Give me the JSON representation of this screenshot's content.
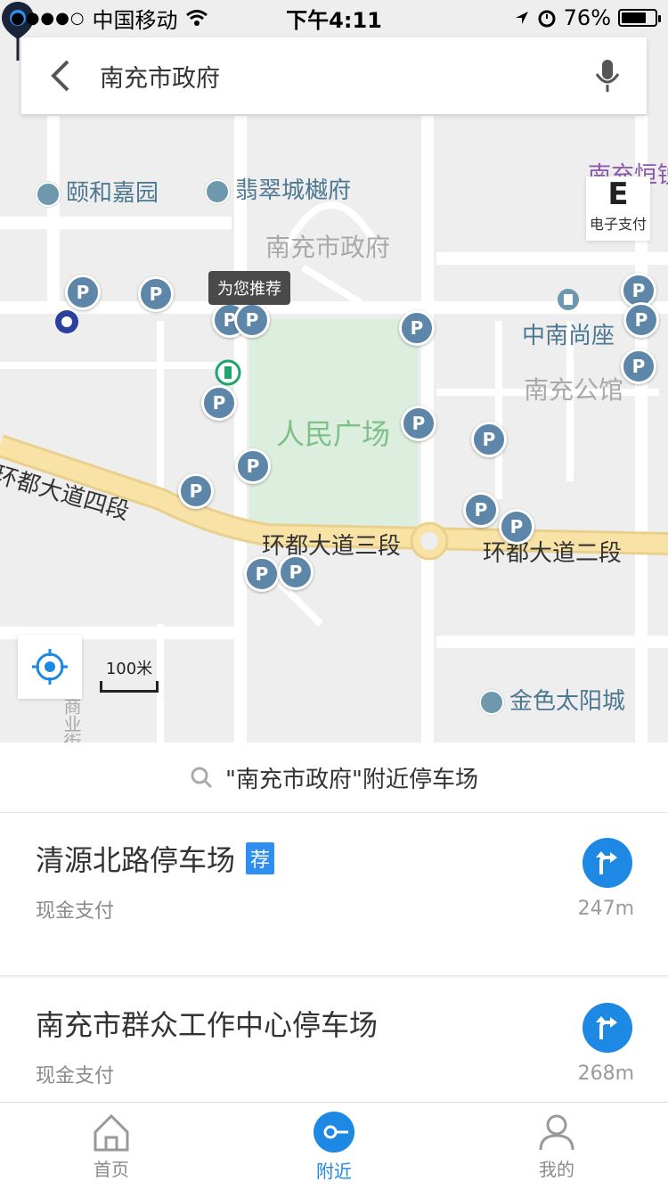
{
  "status_bar": {
    "carrier": "中国移动",
    "time": "下午4:11",
    "battery": "76%",
    "battery_level": 0.76
  },
  "search": {
    "query": "南充市政府"
  },
  "map": {
    "labels": {
      "yihe": "颐和嘉园",
      "feicui": "翡翠城樾府",
      "nanchong_gov": "南充市政府",
      "nanchong_henglong": "南充恒锐",
      "zhongnan": "中南尚座",
      "gongguan": "南充公馆",
      "park": "人民广场",
      "road4": "环都大道四段",
      "road3": "环都大道三段",
      "road2": "环都大道二段",
      "jinse": "金色太阳城",
      "shangye": "商业街"
    },
    "tooltip": "为您推荐",
    "parking_letter": "P",
    "scale": "100米"
  },
  "epay": {
    "letter": "E",
    "label": "电子支付"
  },
  "sheet": {
    "search_summary": "\"南充市政府\"附近停车场",
    "results": [
      {
        "name": "清源北路停车场",
        "badge": "荐",
        "payment": "现金支付",
        "distance": "247m"
      },
      {
        "name": "南充市群众工作中心停车场",
        "payment": "现金支付",
        "distance": "268m"
      }
    ]
  },
  "tabs": [
    {
      "label": "首页"
    },
    {
      "label": "附近"
    },
    {
      "label": "我的"
    }
  ],
  "colors": {
    "accent": "#1e88e5",
    "parking": "#5d86a8",
    "park_green": "#e0eee2",
    "road_yellow": "#f6dc9b"
  }
}
